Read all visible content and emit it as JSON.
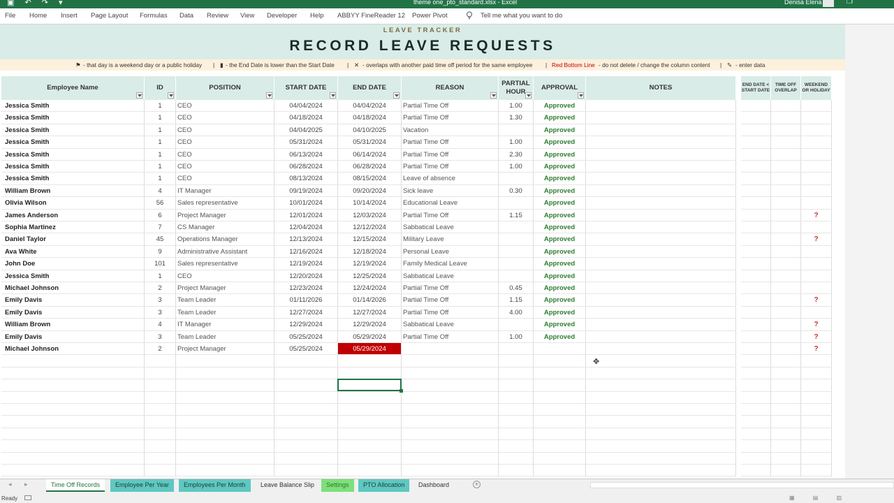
{
  "titlebar": {
    "document": "theme one_pto_standard.xlsx - Excel",
    "user": "Denisa Elena"
  },
  "ribbon": {
    "tabs": [
      "File",
      "Home",
      "Insert",
      "Page Layout",
      "Formulas",
      "Data",
      "Review",
      "View",
      "Developer",
      "Help",
      "ABBYY FineReader 12",
      "Power Pivot",
      "Tell me what you want to do"
    ]
  },
  "banner": {
    "subtitle": "LEAVE TRACKER",
    "title": "RECORD LEAVE REQUESTS"
  },
  "legend": {
    "weekend": "- that day is a weekend day or a public holiday",
    "sep1": "|",
    "enddate": "- the End Date is lower than the Start Date",
    "sep2": "|",
    "overlap_icon": "✕",
    "overlap": "- overlaps with another paid time off period for the same employee",
    "sep3": "|",
    "redline": "Red Bottom Line",
    "redline_desc": "- do not delete / change the column content",
    "sep4": "|",
    "enter": "- enter data"
  },
  "table": {
    "headers": {
      "name": "Employee Name",
      "id": "ID",
      "position": "POSITION",
      "start": "START DATE",
      "end": "END DATE",
      "reason": "REASON",
      "partial": "PARTIAL HOUR",
      "approval": "APPROVAL",
      "notes": "NOTES"
    },
    "check_headers": {
      "enddate": "END DATE < START DATE",
      "overlap": "TIME OFF OVERLAP",
      "weekend": "WEEKEND OR HOLIDAY"
    },
    "rows": [
      {
        "name": "Jessica Smith",
        "id": "1",
        "position": "CEO",
        "start": "04/04/2024",
        "end": "04/04/2024",
        "reason": "Partial Time Off",
        "partial": "1.00",
        "approval": "Approved",
        "weekend": ""
      },
      {
        "name": "Jessica Smith",
        "id": "1",
        "position": "CEO",
        "start": "04/18/2024",
        "end": "04/18/2024",
        "reason": "Partial Time Off",
        "partial": "1.30",
        "approval": "Approved",
        "weekend": ""
      },
      {
        "name": "Jessica Smith",
        "id": "1",
        "position": "CEO",
        "start": "04/04/2025",
        "end": "04/10/2025",
        "reason": "Vacation",
        "partial": "",
        "approval": "Approved",
        "weekend": ""
      },
      {
        "name": "Jessica Smith",
        "id": "1",
        "position": "CEO",
        "start": "05/31/2024",
        "end": "05/31/2024",
        "reason": "Partial Time Off",
        "partial": "1.00",
        "approval": "Approved",
        "weekend": ""
      },
      {
        "name": "Jessica Smith",
        "id": "1",
        "position": "CEO",
        "start": "06/13/2024",
        "end": "06/14/2024",
        "reason": "Partial Time Off",
        "partial": "2.30",
        "approval": "Approved",
        "weekend": ""
      },
      {
        "name": "Jessica Smith",
        "id": "1",
        "position": "CEO",
        "start": "06/28/2024",
        "end": "06/28/2024",
        "reason": "Partial Time Off",
        "partial": "1.00",
        "approval": "Approved",
        "weekend": ""
      },
      {
        "name": "Jessica Smith",
        "id": "1",
        "position": "CEO",
        "start": "08/13/2024",
        "end": "08/15/2024",
        "reason": "Leave of absence",
        "partial": "",
        "approval": "Approved",
        "weekend": ""
      },
      {
        "name": "William Brown",
        "id": "4",
        "position": "IT Manager",
        "start": "09/19/2024",
        "end": "09/20/2024",
        "reason": "Sick leave",
        "partial": "0.30",
        "approval": "Approved",
        "weekend": ""
      },
      {
        "name": "Olivia Wilson",
        "id": "56",
        "position": "Sales representative",
        "start": "10/01/2024",
        "end": "10/14/2024",
        "reason": "Educational Leave",
        "partial": "",
        "approval": "Approved",
        "weekend": ""
      },
      {
        "name": "James Anderson",
        "id": "6",
        "position": "Project Manager",
        "start": "12/01/2024",
        "end": "12/03/2024",
        "reason": "Partial Time Off",
        "partial": "1.15",
        "approval": "Approved",
        "weekend": "?"
      },
      {
        "name": "Sophia Martinez",
        "id": "7",
        "position": "CS Manager",
        "start": "12/04/2024",
        "end": "12/12/2024",
        "reason": "Sabbatical Leave",
        "partial": "",
        "approval": "Approved",
        "weekend": ""
      },
      {
        "name": "Daniel Taylor",
        "id": "45",
        "position": "Operations Manager",
        "start": "12/13/2024",
        "end": "12/15/2024",
        "reason": "Military Leave",
        "partial": "",
        "approval": "Approved",
        "weekend": "?"
      },
      {
        "name": "Ava White",
        "id": "9",
        "position": "Administrative Assistant",
        "start": "12/16/2024",
        "end": "12/18/2024",
        "reason": "Personal Leave",
        "partial": "",
        "approval": "Approved",
        "weekend": ""
      },
      {
        "name": "John Doe",
        "id": "101",
        "position": "Sales representative",
        "start": "12/19/2024",
        "end": "12/19/2024",
        "reason": "Family Medical Leave",
        "partial": "",
        "approval": "Approved",
        "weekend": ""
      },
      {
        "name": "Jessica Smith",
        "id": "1",
        "position": "CEO",
        "start": "12/20/2024",
        "end": "12/25/2024",
        "reason": "Sabbatical Leave",
        "partial": "",
        "approval": "Approved",
        "weekend": ""
      },
      {
        "name": "Michael Johnson",
        "id": "2",
        "position": "Project Manager",
        "start": "12/23/2024",
        "end": "12/24/2024",
        "reason": "Partial Time Off",
        "partial": "0.45",
        "approval": "Approved",
        "weekend": ""
      },
      {
        "name": "Emily Davis",
        "id": "3",
        "position": "Team Leader",
        "start": "01/11/2026",
        "end": "01/14/2026",
        "reason": "Partial Time Off",
        "partial": "1.15",
        "approval": "Approved",
        "weekend": "?"
      },
      {
        "name": "Emily Davis",
        "id": "3",
        "position": "Team Leader",
        "start": "12/27/2024",
        "end": "12/27/2024",
        "reason": "Partial Time Off",
        "partial": "4.00",
        "approval": "Approved",
        "weekend": ""
      },
      {
        "name": "William Brown",
        "id": "4",
        "position": "IT Manager",
        "start": "12/29/2024",
        "end": "12/29/2024",
        "reason": "Sabbatical Leave",
        "partial": "",
        "approval": "Approved",
        "weekend": "?"
      },
      {
        "name": "Emily Davis",
        "id": "3",
        "position": "Team Leader",
        "start": "05/25/2024",
        "end": "05/29/2024",
        "reason": "Partial Time Off",
        "partial": "1.00",
        "approval": "Approved",
        "weekend": "?"
      },
      {
        "name": "Michael Johnson",
        "id": "2",
        "position": "Project Manager",
        "start": "05/25/2024",
        "end": "05/29/2024",
        "reason": "",
        "partial": "",
        "approval": "",
        "weekend": "?",
        "error_end": true
      }
    ]
  },
  "sheet_tabs": [
    {
      "label": "Time Off Records",
      "style": "active"
    },
    {
      "label": "Employee Per Year",
      "style": "teal"
    },
    {
      "label": "Employees Per Month",
      "style": "teal"
    },
    {
      "label": "Leave Balance Slip",
      "style": "plain"
    },
    {
      "label": "Settings",
      "style": "green"
    },
    {
      "label": "PTO Allocation",
      "style": "teal"
    },
    {
      "label": "Dashboard",
      "style": "plain"
    }
  ],
  "status": {
    "ready": "Ready"
  },
  "colors": {
    "accent": "#217346",
    "header_bg": "#d9ece8",
    "legend_bg": "#fdf0dc",
    "approved": "#2e7d32",
    "error": "#c00000"
  }
}
